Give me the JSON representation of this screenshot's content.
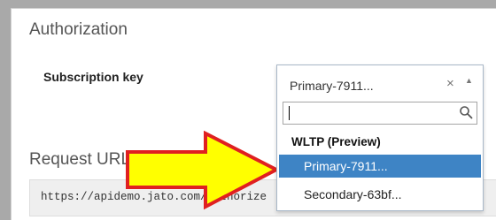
{
  "authorization": {
    "title": "Authorization",
    "subscription_key_label": "Subscription key"
  },
  "request_url": {
    "title": "Request URL",
    "value": "https://apidemo.jato.com/authorize"
  },
  "dropdown": {
    "selected_value": "Primary-7911...",
    "clear_icon": "×",
    "toggle_icon": "▲",
    "search_value": "",
    "group_label": "WLTP (Preview)",
    "options": [
      {
        "label": "Primary-7911...",
        "selected": true
      },
      {
        "label": "Secondary-63bf...",
        "selected": false
      }
    ]
  },
  "icons": {
    "clear": "close-icon",
    "toggle": "caret-up-icon",
    "search": "search-icon",
    "annotation": "arrow-right-annotation"
  },
  "colors": {
    "highlight": "#3e84c5",
    "arrow_fill": "#ffff00",
    "arrow_stroke": "#e02020",
    "url_box_bg": "#efefef"
  }
}
